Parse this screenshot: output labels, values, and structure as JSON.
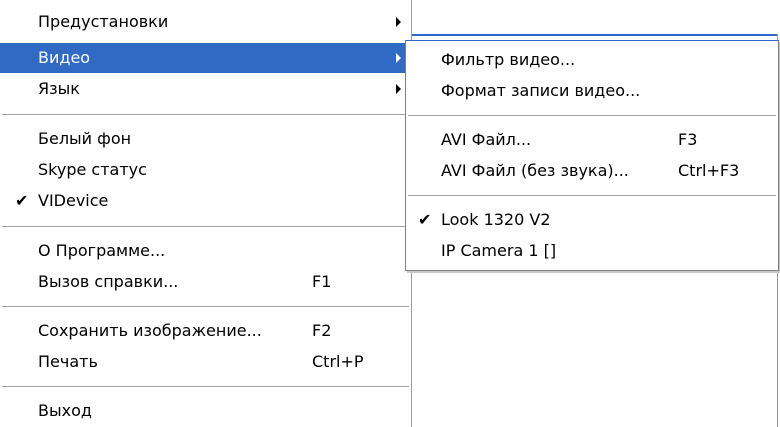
{
  "main_menu": {
    "presets": "Предустановки",
    "video": "Видео",
    "language": "Язык",
    "white_bg": "Белый фон",
    "skype_status": "Skype статус",
    "videvice": "VIDevice",
    "about": "О Программе...",
    "help": "Вызов справки...",
    "help_shortcut": "F1",
    "save_image": "Сохранить изображение...",
    "save_shortcut": "F2",
    "print": "Печать",
    "print_shortcut": "Ctrl+P",
    "exit": "Выход",
    "check_mark": "✔"
  },
  "video_submenu": {
    "video_filter": "Фильтр видео...",
    "record_format": "Формат записи видео...",
    "avi_file": "AVI Файл...",
    "avi_shortcut": "F3",
    "avi_nosound": "AVI Файл (без звука)...",
    "avi_nosound_shortcut": "Ctrl+F3",
    "look_1320": "Look 1320 V2",
    "ip_camera": "IP Camera 1 []",
    "check_mark": "✔"
  },
  "colors": {
    "selection": "#316ac5",
    "accent_line": "#3366cc"
  }
}
